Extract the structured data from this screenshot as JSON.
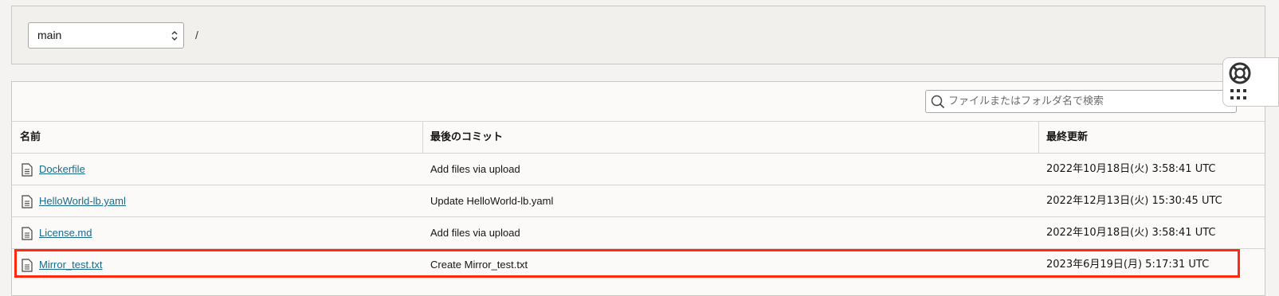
{
  "branch_selector": {
    "value": "main"
  },
  "path": {
    "separator": "/"
  },
  "search": {
    "placeholder": "ファイルまたはフォルダ名で検索"
  },
  "table": {
    "headers": {
      "name": "名前",
      "last_commit": "最後のコミット",
      "last_updated": "最終更新"
    },
    "rows": [
      {
        "name": "Dockerfile",
        "commit": "Add files via upload",
        "updated": "2022年10月18日(火) 3:58:41 UTC",
        "icon": "file-icon"
      },
      {
        "name": "HelloWorld-lb.yaml",
        "commit": "Update HelloWorld-lb.yaml",
        "updated": "2022年12月13日(火) 15:30:45 UTC",
        "icon": "file-icon"
      },
      {
        "name": "License.md",
        "commit": "Add files via upload",
        "updated": "2022年10月18日(火) 3:58:41 UTC",
        "icon": "file-icon"
      },
      {
        "name": "Mirror_test.txt",
        "commit": "Create Mirror_test.txt",
        "updated": "2023年6月19日(月) 5:17:31 UTC",
        "icon": "file-icon",
        "highlighted": true
      }
    ]
  },
  "side_widget": {
    "icons": [
      "help-lifebuoy-icon",
      "apps-grid-icon"
    ]
  },
  "colors": {
    "link": "#1a6a8a",
    "highlight": "#ff2a0f",
    "border": "#c9c7c3"
  }
}
